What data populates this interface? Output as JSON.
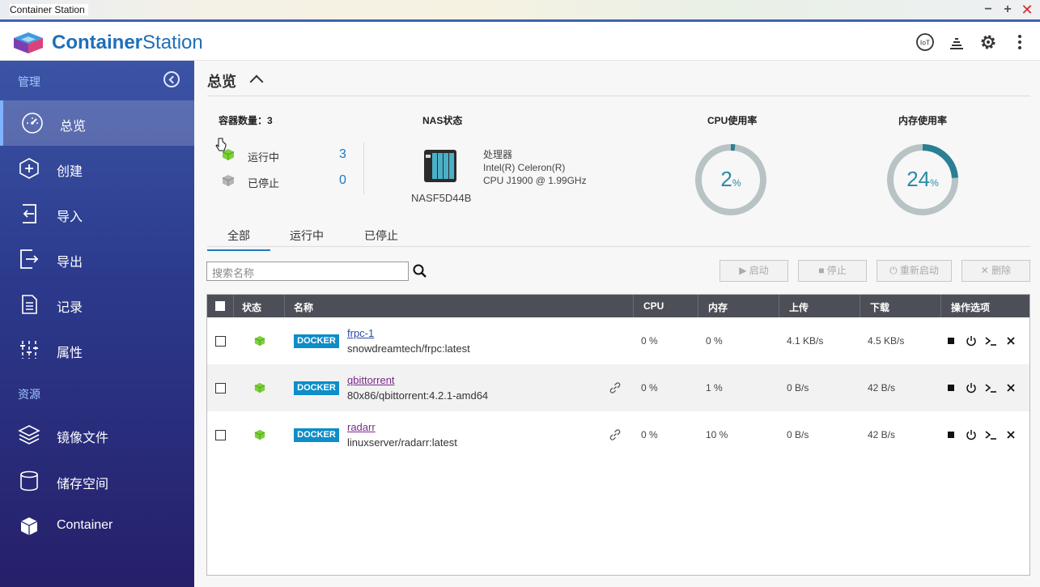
{
  "window": {
    "title": "Container Station",
    "min": "−",
    "max": "+",
    "close": "✕"
  },
  "header": {
    "brand_bold": "Container",
    "brand_light": "Station"
  },
  "sidebar": {
    "manage_label": "管理",
    "items": [
      {
        "label": "总览"
      },
      {
        "label": "创建"
      },
      {
        "label": "导入"
      },
      {
        "label": "导出"
      },
      {
        "label": "记录"
      },
      {
        "label": "属性"
      }
    ],
    "resources_label": "资源",
    "resources": [
      {
        "label": "镜像文件"
      },
      {
        "label": "储存空间"
      },
      {
        "label": "Container"
      }
    ]
  },
  "overview": {
    "title": "总览",
    "count_title": "容器数量：3",
    "running_label": "运行中",
    "running_count": "3",
    "stopped_label": "已停止",
    "stopped_count": "0",
    "nas_title": "NAS状态",
    "nas_name": "NASF5D44B",
    "cpu_label": "处理器",
    "cpu_model1": "Intel(R) Celeron(R)",
    "cpu_model2": "CPU J1900 @ 1.99GHz",
    "cpu_usage_title": "CPU使用率",
    "cpu_usage": "2",
    "mem_usage_title": "内存使用率",
    "mem_usage": "24",
    "percent": "%"
  },
  "gauges": {
    "cpu_fraction": 0.02,
    "mem_fraction": 0.24,
    "track_color": "#b9c2c4",
    "fill_color": "#2b7f93"
  },
  "tabs": [
    "全部",
    "运行中",
    "已停止"
  ],
  "toolbar": {
    "search_placeholder": "搜索名称",
    "start": "▶ 启动",
    "stop": "■ 停止",
    "restart": "⏻ 重新启动",
    "delete": "✕ 删除"
  },
  "table": {
    "headers": {
      "status": "状态",
      "name": "名称",
      "cpu": "CPU",
      "mem": "内存",
      "up": "上传",
      "down": "下载",
      "ops": "操作选项"
    },
    "badge": "DOCKER",
    "rows": [
      {
        "name": "frpc-1",
        "image": "snowdreamtech/frpc:latest",
        "cpu": "0 %",
        "mem": "0 %",
        "up": "4.1 KB/s",
        "down": "4.5 KB/s",
        "link": false
      },
      {
        "name": "qbittorrent",
        "image": "80x86/qbittorrent:4.2.1-amd64",
        "cpu": "0 %",
        "mem": "1 %",
        "up": "0 B/s",
        "down": "42 B/s",
        "link": true
      },
      {
        "name": "radarr",
        "image": "linuxserver/radarr:latest",
        "cpu": "0 %",
        "mem": "10 %",
        "up": "0 B/s",
        "down": "42 B/s",
        "link": true
      }
    ]
  },
  "colors": {
    "accent": "#1b7bc1",
    "docker": "#0e8dc9",
    "running_green": "#6fbf2e"
  }
}
